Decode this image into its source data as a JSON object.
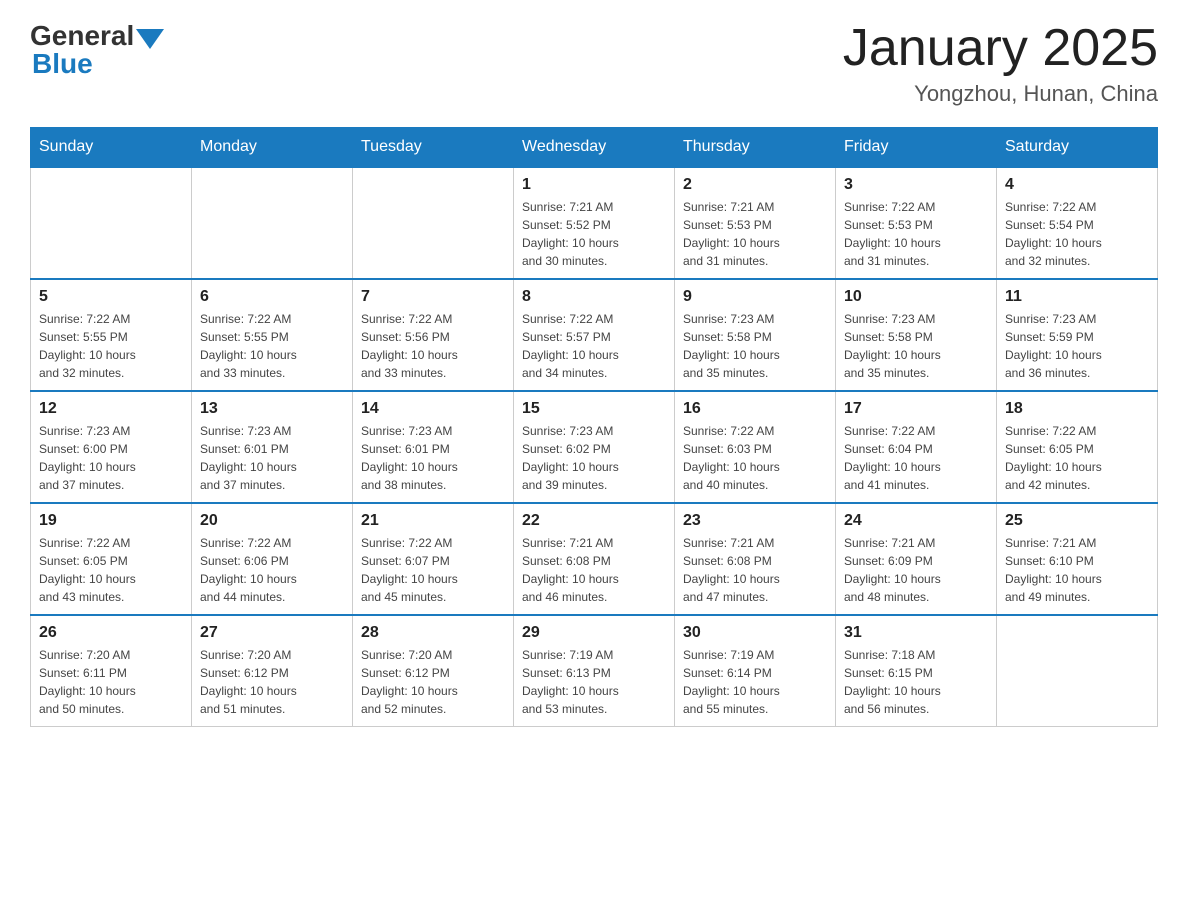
{
  "logo": {
    "general": "General",
    "blue": "Blue"
  },
  "title": {
    "month_year": "January 2025",
    "location": "Yongzhou, Hunan, China"
  },
  "days_of_week": [
    "Sunday",
    "Monday",
    "Tuesday",
    "Wednesday",
    "Thursday",
    "Friday",
    "Saturday"
  ],
  "weeks": [
    [
      {
        "day": "",
        "info": ""
      },
      {
        "day": "",
        "info": ""
      },
      {
        "day": "",
        "info": ""
      },
      {
        "day": "1",
        "info": "Sunrise: 7:21 AM\nSunset: 5:52 PM\nDaylight: 10 hours\nand 30 minutes."
      },
      {
        "day": "2",
        "info": "Sunrise: 7:21 AM\nSunset: 5:53 PM\nDaylight: 10 hours\nand 31 minutes."
      },
      {
        "day": "3",
        "info": "Sunrise: 7:22 AM\nSunset: 5:53 PM\nDaylight: 10 hours\nand 31 minutes."
      },
      {
        "day": "4",
        "info": "Sunrise: 7:22 AM\nSunset: 5:54 PM\nDaylight: 10 hours\nand 32 minutes."
      }
    ],
    [
      {
        "day": "5",
        "info": "Sunrise: 7:22 AM\nSunset: 5:55 PM\nDaylight: 10 hours\nand 32 minutes."
      },
      {
        "day": "6",
        "info": "Sunrise: 7:22 AM\nSunset: 5:55 PM\nDaylight: 10 hours\nand 33 minutes."
      },
      {
        "day": "7",
        "info": "Sunrise: 7:22 AM\nSunset: 5:56 PM\nDaylight: 10 hours\nand 33 minutes."
      },
      {
        "day": "8",
        "info": "Sunrise: 7:22 AM\nSunset: 5:57 PM\nDaylight: 10 hours\nand 34 minutes."
      },
      {
        "day": "9",
        "info": "Sunrise: 7:23 AM\nSunset: 5:58 PM\nDaylight: 10 hours\nand 35 minutes."
      },
      {
        "day": "10",
        "info": "Sunrise: 7:23 AM\nSunset: 5:58 PM\nDaylight: 10 hours\nand 35 minutes."
      },
      {
        "day": "11",
        "info": "Sunrise: 7:23 AM\nSunset: 5:59 PM\nDaylight: 10 hours\nand 36 minutes."
      }
    ],
    [
      {
        "day": "12",
        "info": "Sunrise: 7:23 AM\nSunset: 6:00 PM\nDaylight: 10 hours\nand 37 minutes."
      },
      {
        "day": "13",
        "info": "Sunrise: 7:23 AM\nSunset: 6:01 PM\nDaylight: 10 hours\nand 37 minutes."
      },
      {
        "day": "14",
        "info": "Sunrise: 7:23 AM\nSunset: 6:01 PM\nDaylight: 10 hours\nand 38 minutes."
      },
      {
        "day": "15",
        "info": "Sunrise: 7:23 AM\nSunset: 6:02 PM\nDaylight: 10 hours\nand 39 minutes."
      },
      {
        "day": "16",
        "info": "Sunrise: 7:22 AM\nSunset: 6:03 PM\nDaylight: 10 hours\nand 40 minutes."
      },
      {
        "day": "17",
        "info": "Sunrise: 7:22 AM\nSunset: 6:04 PM\nDaylight: 10 hours\nand 41 minutes."
      },
      {
        "day": "18",
        "info": "Sunrise: 7:22 AM\nSunset: 6:05 PM\nDaylight: 10 hours\nand 42 minutes."
      }
    ],
    [
      {
        "day": "19",
        "info": "Sunrise: 7:22 AM\nSunset: 6:05 PM\nDaylight: 10 hours\nand 43 minutes."
      },
      {
        "day": "20",
        "info": "Sunrise: 7:22 AM\nSunset: 6:06 PM\nDaylight: 10 hours\nand 44 minutes."
      },
      {
        "day": "21",
        "info": "Sunrise: 7:22 AM\nSunset: 6:07 PM\nDaylight: 10 hours\nand 45 minutes."
      },
      {
        "day": "22",
        "info": "Sunrise: 7:21 AM\nSunset: 6:08 PM\nDaylight: 10 hours\nand 46 minutes."
      },
      {
        "day": "23",
        "info": "Sunrise: 7:21 AM\nSunset: 6:08 PM\nDaylight: 10 hours\nand 47 minutes."
      },
      {
        "day": "24",
        "info": "Sunrise: 7:21 AM\nSunset: 6:09 PM\nDaylight: 10 hours\nand 48 minutes."
      },
      {
        "day": "25",
        "info": "Sunrise: 7:21 AM\nSunset: 6:10 PM\nDaylight: 10 hours\nand 49 minutes."
      }
    ],
    [
      {
        "day": "26",
        "info": "Sunrise: 7:20 AM\nSunset: 6:11 PM\nDaylight: 10 hours\nand 50 minutes."
      },
      {
        "day": "27",
        "info": "Sunrise: 7:20 AM\nSunset: 6:12 PM\nDaylight: 10 hours\nand 51 minutes."
      },
      {
        "day": "28",
        "info": "Sunrise: 7:20 AM\nSunset: 6:12 PM\nDaylight: 10 hours\nand 52 minutes."
      },
      {
        "day": "29",
        "info": "Sunrise: 7:19 AM\nSunset: 6:13 PM\nDaylight: 10 hours\nand 53 minutes."
      },
      {
        "day": "30",
        "info": "Sunrise: 7:19 AM\nSunset: 6:14 PM\nDaylight: 10 hours\nand 55 minutes."
      },
      {
        "day": "31",
        "info": "Sunrise: 7:18 AM\nSunset: 6:15 PM\nDaylight: 10 hours\nand 56 minutes."
      },
      {
        "day": "",
        "info": ""
      }
    ]
  ]
}
